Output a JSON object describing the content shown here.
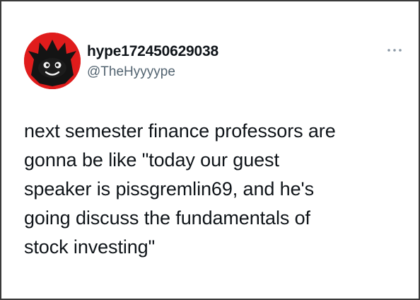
{
  "tweet": {
    "author": {
      "display_name": "hype172450629038",
      "handle": "@TheHyyyype",
      "avatar_icon": "red-cartoon-face-avatar",
      "avatar_color": "#e01c1c"
    },
    "more_icon": "more-options-icon",
    "text_lines": [
      "next semester finance professors are",
      "gonna be like \"today our guest",
      "speaker is pissgremlin69, and he's",
      "going discuss the fundamentals of",
      "stock investing\""
    ]
  }
}
